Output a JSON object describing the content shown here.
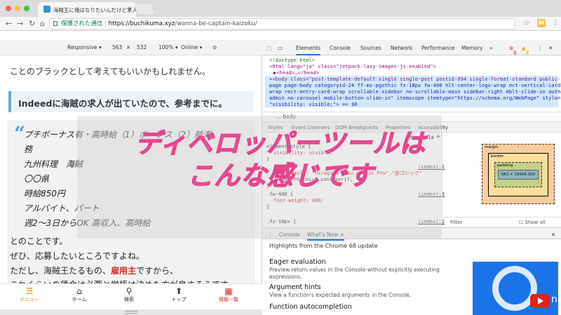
{
  "browser": {
    "tab_title": "海賊王に俺はなりたいんだけど求人",
    "secure_label": "保護された通信",
    "url_host": "https://buchikuma.xyz",
    "url_path": "/wanna-be-captain-kaizoku/",
    "extension_letter": "W"
  },
  "device_toolbar": {
    "device": "Responsive ▾",
    "width": "563",
    "times": "×",
    "height": "532",
    "zoom": "100% ▾",
    "network": "Online ▾"
  },
  "page": {
    "top_line": "ことのブラックとして考えてもいいかもしれません。",
    "indeed_heading": "Indeedに海賊の求人が出ていたので、参考までに。",
    "quote_lines": [
      "プチボーナス有・高時給（1）ボーナス（2）航海",
      "務",
      "九州料理　海賊",
      "〇〇県",
      "時給850円",
      "アルバイト、パート",
      "週2～3日からOK 高収入、高時給"
    ],
    "body_lines": [
      "とのことです。",
      "ぜひ、応募したいところですよね。"
    ],
    "body_line3_pre": "ただし、海賊王たるもの、",
    "body_line3_red": "雇用主",
    "body_line3_post": "ですから、",
    "body_line4": "これくらいの賃金は必要と覚悟は決めた方が良さそうです。",
    "bottom_nav": [
      {
        "label": "メニュー",
        "icon": "menu-icon"
      },
      {
        "label": "ホーム",
        "icon": "home-icon"
      },
      {
        "label": "検索",
        "icon": "search-icon"
      },
      {
        "label": "トップ",
        "icon": "arrow-up-icon"
      },
      {
        "label": "情報一覧",
        "icon": "list-icon"
      }
    ]
  },
  "devtools": {
    "tabs": [
      "Elements",
      "Console",
      "Sources",
      "Network",
      "Performance",
      "Memory",
      "»"
    ],
    "error_count": "6",
    "warning_count": "4",
    "dom": {
      "doctype": "<!doctype html>",
      "html_open": "<html lang=\"ja\" class=\"jetpack-lazy-images-js-enabled\">",
      "head": "▶<head>…</head>",
      "body_line1": "▾<body class=\"post-template-default single single-post postid-694 single-format-standard public-",
      "body_line2": "page page-body categoryid-24 ff-ms-pgothic fz-18px fw-400 hlt-center-logo-wrap ect-vertical-card-2-",
      "body_line3": "wrap rect-entry-card-wrap scrollable-sidebar no-scrollable-main sidebar-right mblt-slide-in author-",
      "body_line4": "admin no-carousel mobile-button-slide-in\" itemscope itemtype=\"https://schema.org/WebPage\" style=",
      "body_line5": "\"visibility: visible;\"> == $0"
    },
    "breadcrumb": "...     body",
    "sub_tabs": [
      "Styles",
      "Event Listeners",
      "DOM Breakpoints",
      "Properties",
      "Accessibility"
    ],
    "styles": {
      "hov": ":hov",
      "cls": ".cls",
      "plus": "+",
      "element_style": "element.style {",
      "visibility": "visibility: visible;",
      "close": "}",
      "font_family": "font-family: \"Hiragino Kaku Gothic Pro\",\"游ゴシック\"",
      "font_family_cont": "\"MS PGothic\",sans-serif;",
      "fw_selector": ".fw-400 {",
      "fw_prop": "font-weight: 400;",
      "fz_selector": ".fz-18px {",
      "src1": "(index):2",
      "src2": "(index):2",
      "src3": "(index):2"
    },
    "box_model": {
      "margin": "margin",
      "border": "border",
      "padding": "padding",
      "content": "563 × 19904.300",
      "dash": "-"
    },
    "filter": "Filter",
    "show_all": "Show all",
    "drawer_tabs": [
      "Console",
      "What's New ×"
    ],
    "whats_new": {
      "highlights": "Highlights from the Chrome 68 update",
      "items": [
        {
          "title": "Eager evaluation",
          "desc": "Preview return values in the Console without explicitly executing expressions."
        },
        {
          "title": "Argument hints",
          "desc": "View a function's expected arguments in the Console."
        },
        {
          "title": "Function autocompletion",
          "desc": ""
        }
      ],
      "thumb_text": "n"
    }
  },
  "caption": {
    "line1": "ディベロッパーツールは",
    "line2": "こんな感じです"
  },
  "colors": {
    "caption": "#ef5ea0",
    "menu_orange": "#e38b00",
    "info_red": "#d82a2a",
    "chrome_blue": "#1a73e8"
  }
}
